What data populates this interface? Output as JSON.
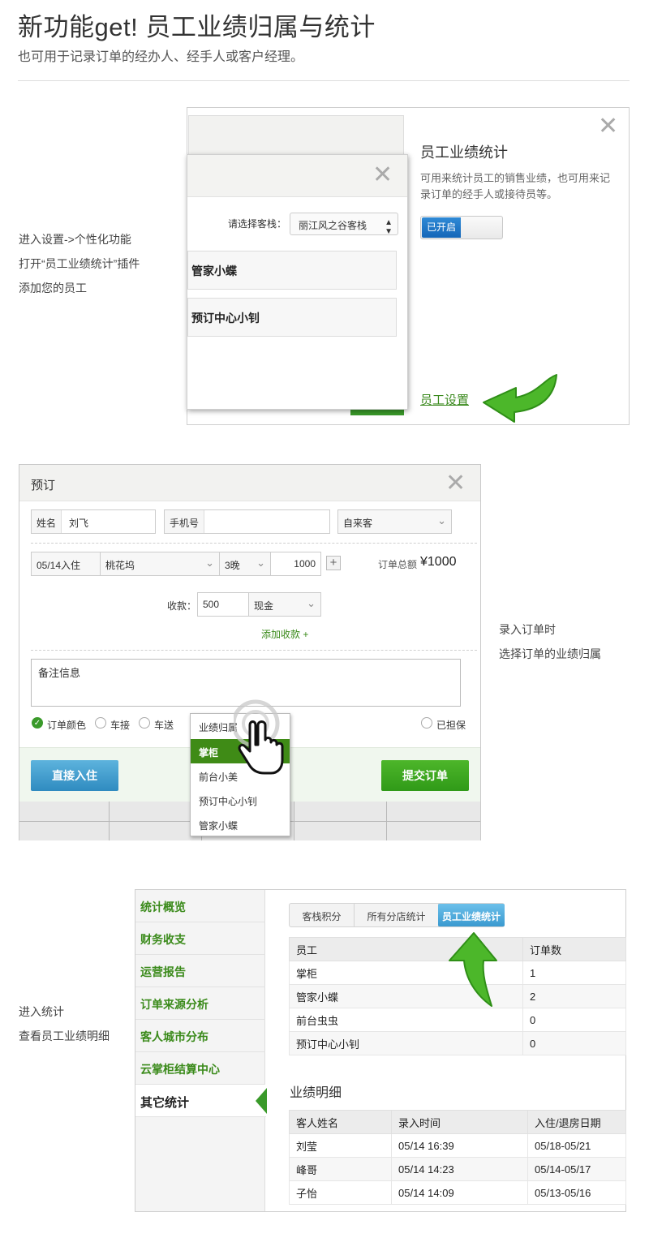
{
  "header": {
    "title": "新功能get! 员工业绩归属与统计",
    "subtitle": "也可用于记录订单的经办人、经手人或客户经理。"
  },
  "section1": {
    "notes": [
      "进入设置->个性化功能",
      "打开“员工业绩统计”插件",
      "添加您的员工"
    ],
    "select_label": "请选择客栈：",
    "select_value": "丽江风之谷客栈",
    "staff": [
      "管家小蝶",
      "预订中心小钊"
    ],
    "feature_title": "员工业绩统计",
    "feature_desc": "可用来统计员工的销售业绩，也可用来记录订单的经手人或接待员等。",
    "toggle_label": "已开启",
    "staff_settings_link": "员工设置",
    "close": "✕"
  },
  "section2": {
    "notes": [
      "录入订单时",
      "选择订单的业绩归属"
    ],
    "dialog_title": "预订",
    "close": "✕",
    "name_label": "姓名",
    "name_value": "刘飞",
    "phone_label": "手机号",
    "phone_value": "",
    "source_value": "自来客",
    "checkin_value": "05/14入住",
    "room_value": "桃花坞",
    "nights_value": "3晚",
    "price_value": "1000",
    "plus": "+",
    "order_total_label": "订单总额",
    "order_total_value": "¥1000",
    "payment_label": "收款：",
    "payment_value": "500",
    "payment_method": "现金",
    "add_payment": "添加收款 +",
    "remark_value": "备注信息",
    "options": {
      "order_color": "订单颜色",
      "pickup": "车接",
      "dropoff": "车送",
      "guaranteed": "已担保"
    },
    "attribution_dropdown": {
      "header": "业绩归属",
      "items": [
        "掌柜",
        "前台小美",
        "预订中心小钊",
        "管家小蝶"
      ],
      "selected": "掌柜"
    },
    "checkin_button": "直接入住",
    "submit_button": "提交订单"
  },
  "section3": {
    "notes": [
      "进入统计",
      "查看员工业绩明细"
    ],
    "sidebar": [
      "统计概览",
      "财务收支",
      "运营报告",
      "订单来源分析",
      "客人城市分布",
      "云掌柜结算中心",
      "其它统计"
    ],
    "tabs": [
      "客栈积分",
      "所有分店统计",
      "员工业绩统计"
    ],
    "staff_table": {
      "headers": [
        "员工",
        "订单数"
      ],
      "rows": [
        [
          "掌柜",
          "1"
        ],
        [
          "管家小蝶",
          "2"
        ],
        [
          "前台虫虫",
          "0"
        ],
        [
          "预订中心小钊",
          "0"
        ]
      ]
    },
    "detail_title": "业绩明细",
    "detail_table": {
      "headers": [
        "客人姓名",
        "录入时间",
        "入住/退房日期"
      ],
      "rows": [
        [
          "刘莹",
          "05/14 16:39",
          "05/18-05/21"
        ],
        [
          "峰哥",
          "05/14 14:23",
          "05/14-05/17"
        ],
        [
          "子怡",
          "05/14 14:09",
          "05/13-05/16"
        ]
      ]
    }
  },
  "colors": {
    "accent_green": "#3a9a2a",
    "link_green": "#3b8a1e",
    "blue": "#2f8bc0"
  }
}
